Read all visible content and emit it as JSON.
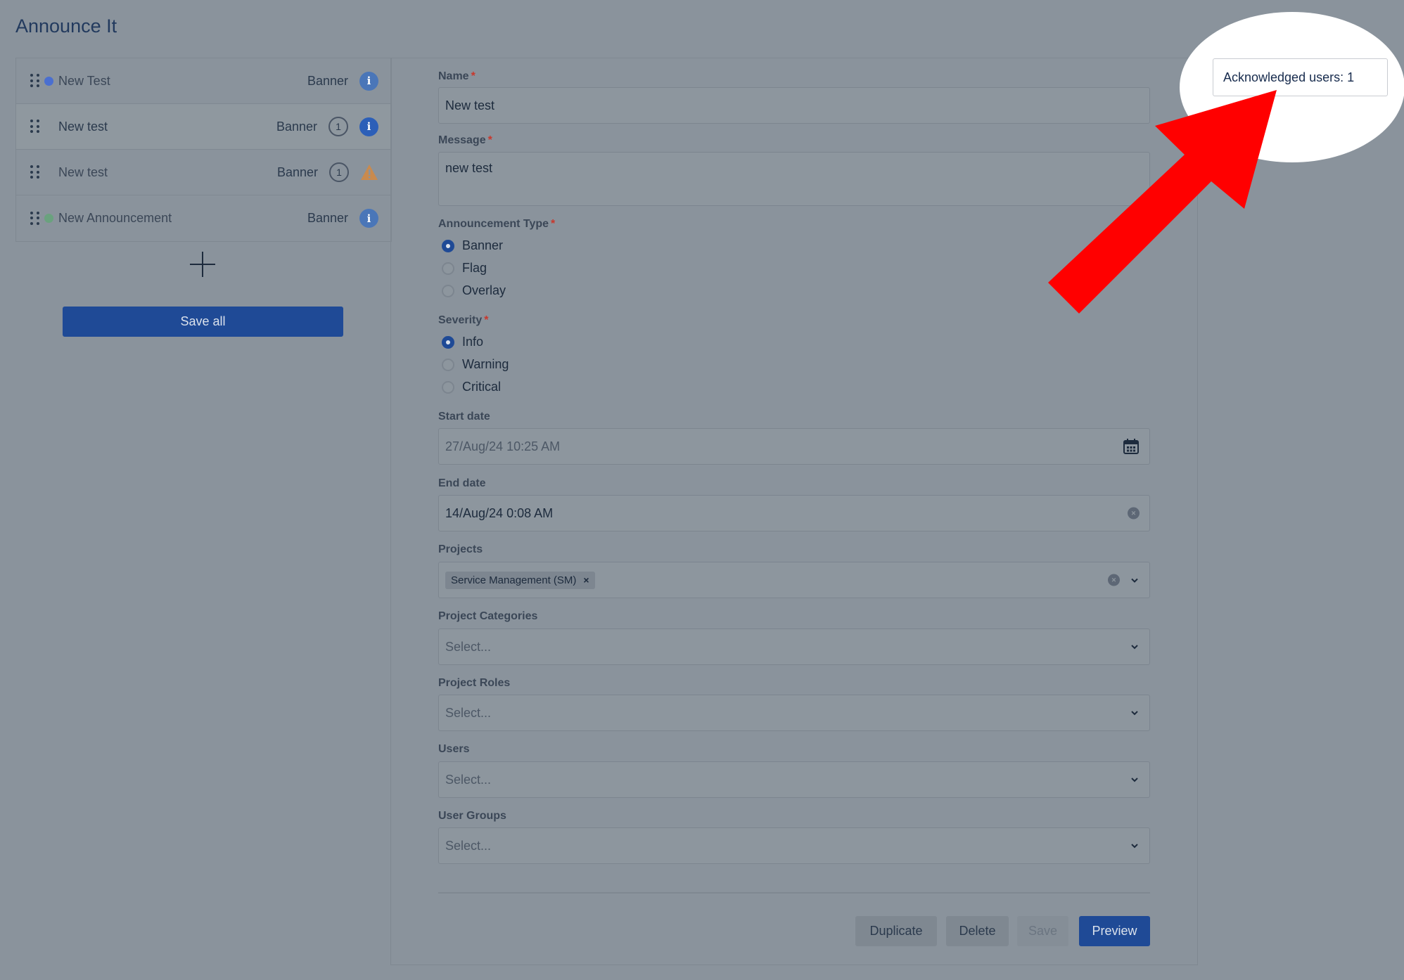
{
  "app": {
    "title": "Announce It"
  },
  "sidebar": {
    "items": [
      {
        "name": "New Test",
        "type": "Banner",
        "status_color": "#4a6fd0",
        "count": "",
        "severity": "info"
      },
      {
        "name": "New test",
        "type": "Banner",
        "status_color": "",
        "count": "1",
        "severity": "info"
      },
      {
        "name": "New test",
        "type": "Banner",
        "status_color": "",
        "count": "1",
        "severity": "warning"
      },
      {
        "name": "New Announcement",
        "type": "Banner",
        "status_color": "#6aa27e",
        "count": "",
        "severity": "info"
      }
    ],
    "save_all_label": "Save all"
  },
  "form": {
    "name": {
      "label": "Name",
      "value": "New test"
    },
    "message": {
      "label": "Message",
      "value": "new test"
    },
    "announcement_type": {
      "label": "Announcement Type",
      "options": [
        "Banner",
        "Flag",
        "Overlay"
      ],
      "selected": "Banner"
    },
    "severity": {
      "label": "Severity",
      "options": [
        "Info",
        "Warning",
        "Critical"
      ],
      "selected": "Info"
    },
    "start_date": {
      "label": "Start date",
      "value": "27/Aug/24 10:25 AM"
    },
    "end_date": {
      "label": "End date",
      "value": "14/Aug/24 0:08 AM"
    },
    "projects": {
      "label": "Projects",
      "tags": [
        "Service Management (SM)"
      ]
    },
    "project_categories": {
      "label": "Project Categories",
      "placeholder": "Select..."
    },
    "project_roles": {
      "label": "Project Roles",
      "placeholder": "Select..."
    },
    "users": {
      "label": "Users",
      "placeholder": "Select..."
    },
    "user_groups": {
      "label": "User Groups",
      "placeholder": "Select..."
    },
    "required_marker": "*"
  },
  "actions": {
    "duplicate": "Duplicate",
    "delete": "Delete",
    "save": "Save",
    "preview": "Preview"
  },
  "acknowledged": {
    "label": "Acknowledged users: 1"
  },
  "colors": {
    "primary": "#1f4a96",
    "info": "#4a76b8",
    "warning": "#c98a4e",
    "arrow": "#ff0000"
  }
}
